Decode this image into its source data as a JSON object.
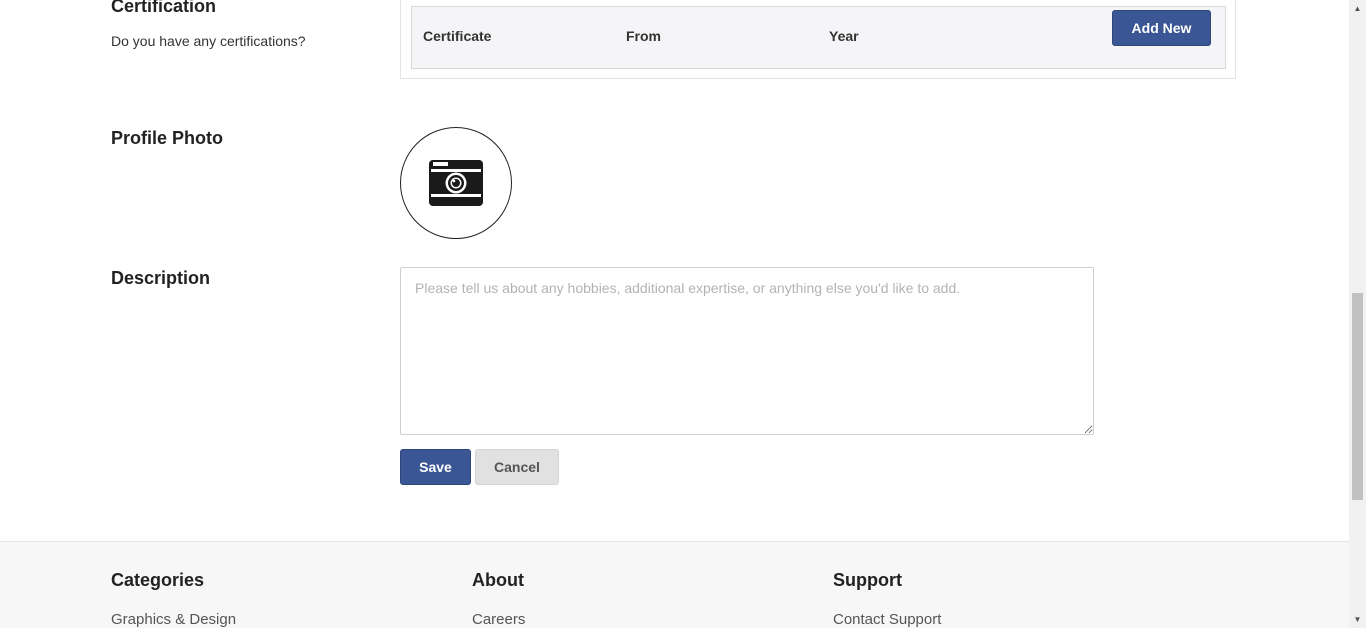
{
  "certification": {
    "title": "Certification",
    "subtitle": "Do you have any certifications?",
    "columns": [
      "Certificate",
      "From",
      "Year"
    ],
    "add_button": "Add New"
  },
  "profile_photo": {
    "title": "Profile Photo",
    "icon": "camera-icon"
  },
  "description": {
    "title": "Description",
    "value": "",
    "placeholder": "Please tell us about any hobbies, additional expertise, or anything else you'd like to add."
  },
  "actions": {
    "save_label": "Save",
    "cancel_label": "Cancel"
  },
  "footer": {
    "columns": [
      {
        "heading": "Categories",
        "links": [
          "Graphics & Design"
        ]
      },
      {
        "heading": "About",
        "links": [
          "Careers"
        ]
      },
      {
        "heading": "Support",
        "links": [
          "Contact Support"
        ]
      }
    ]
  },
  "colors": {
    "primary_button": "#3b5694",
    "cancel_button": "#e1e1e1",
    "footer_background": "#f7f7f7"
  }
}
